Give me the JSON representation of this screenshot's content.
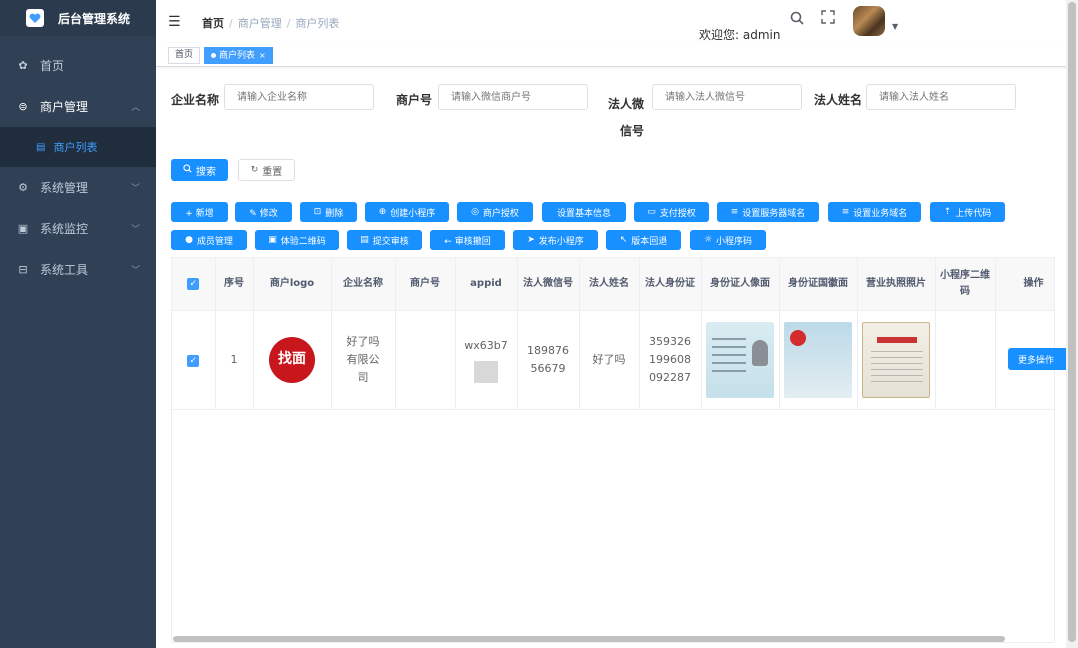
{
  "app": {
    "title": "后台管理系统"
  },
  "sidebar": {
    "items": [
      {
        "label": "首页",
        "icon": "dashboard-icon"
      },
      {
        "label": "商户管理",
        "icon": "merchant-icon",
        "expanded": true
      },
      {
        "label": "商户列表",
        "icon": "list-icon",
        "active": true
      },
      {
        "label": "系统管理",
        "icon": "gear-icon"
      },
      {
        "label": "系统监控",
        "icon": "monitor-icon"
      },
      {
        "label": "系统工具",
        "icon": "toolbox-icon"
      }
    ]
  },
  "header": {
    "breadcrumb": [
      "首页",
      "商户管理",
      "商户列表"
    ],
    "welcome": "欢迎您: admin"
  },
  "tags": [
    {
      "label": "首页"
    },
    {
      "label": "商户列表",
      "active": true
    }
  ],
  "search": {
    "fields": [
      {
        "label": "企业名称",
        "placeholder": "请输入企业名称"
      },
      {
        "label": "商户号",
        "placeholder": "请输入微信商户号"
      },
      {
        "label": "法人微信号",
        "placeholder": "请输入法人微信号"
      },
      {
        "label": "法人姓名",
        "placeholder": "请输入法人姓名"
      }
    ],
    "search_label": "搜索",
    "reset_label": "重置"
  },
  "toolbar": {
    "row1": [
      "+ 新增",
      "✎ 修改",
      "删除",
      "创建小程序",
      "商户授权",
      "设置基本信息",
      "支付授权",
      "设置服务器域名",
      "设置业务域名",
      "上传代码"
    ],
    "row2": [
      "成员管理",
      "体验二维码",
      "提交审核",
      "← 审核撤回",
      "发布小程序",
      "版本回退",
      "小程序码"
    ]
  },
  "table": {
    "headers": [
      "序号",
      "商户logo",
      "企业名称",
      "商户号",
      "appid",
      "法人微信号",
      "法人姓名",
      "法人身份证",
      "身份证人像面",
      "身份证国徽面",
      "营业执照照片",
      "小程序二维码",
      "操作"
    ],
    "rows": [
      {
        "index": "1",
        "logo_text": "找面",
        "company": "好了吗有限公司",
        "merchant_no": "",
        "appid": "wx63b7",
        "wechat": "18987656679",
        "name": "好了吗",
        "id_card": "359326199608092287",
        "more_label": "更多操作"
      }
    ]
  },
  "colors": {
    "primary": "#1890ff",
    "sidebar_bg": "#304156",
    "active_text": "#409eff"
  }
}
